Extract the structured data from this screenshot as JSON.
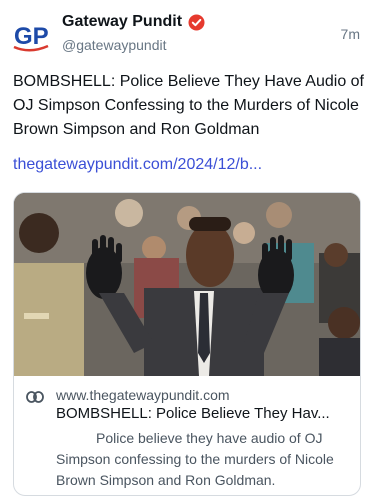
{
  "author": {
    "display_name": "Gateway Pundit",
    "handle": "@gatewaypundit",
    "avatar_text": "GP",
    "verified_icon": "verified-badge-icon"
  },
  "post": {
    "timestamp": "7m",
    "text": "BOMBSHELL: Police Believe They Have Audio of OJ Simpson Confessing to the Murders of Nicole Brown Simpson and Ron Goldman",
    "link": "thegatewaypundit.com/2024/12/b..."
  },
  "card": {
    "link_icon": "link-icon",
    "domain": "www.thegatewaypundit.com",
    "title": "BOMBSHELL: Police Believe They Hav...",
    "description": "Police believe they have audio of OJ Simpson confessing to the murders of Nicole Brown Simpson and Ron Goldman."
  },
  "colors": {
    "link": "#3b4fd6",
    "avatar_blue": "#1d4aa8",
    "badge": "#e63a2e"
  }
}
